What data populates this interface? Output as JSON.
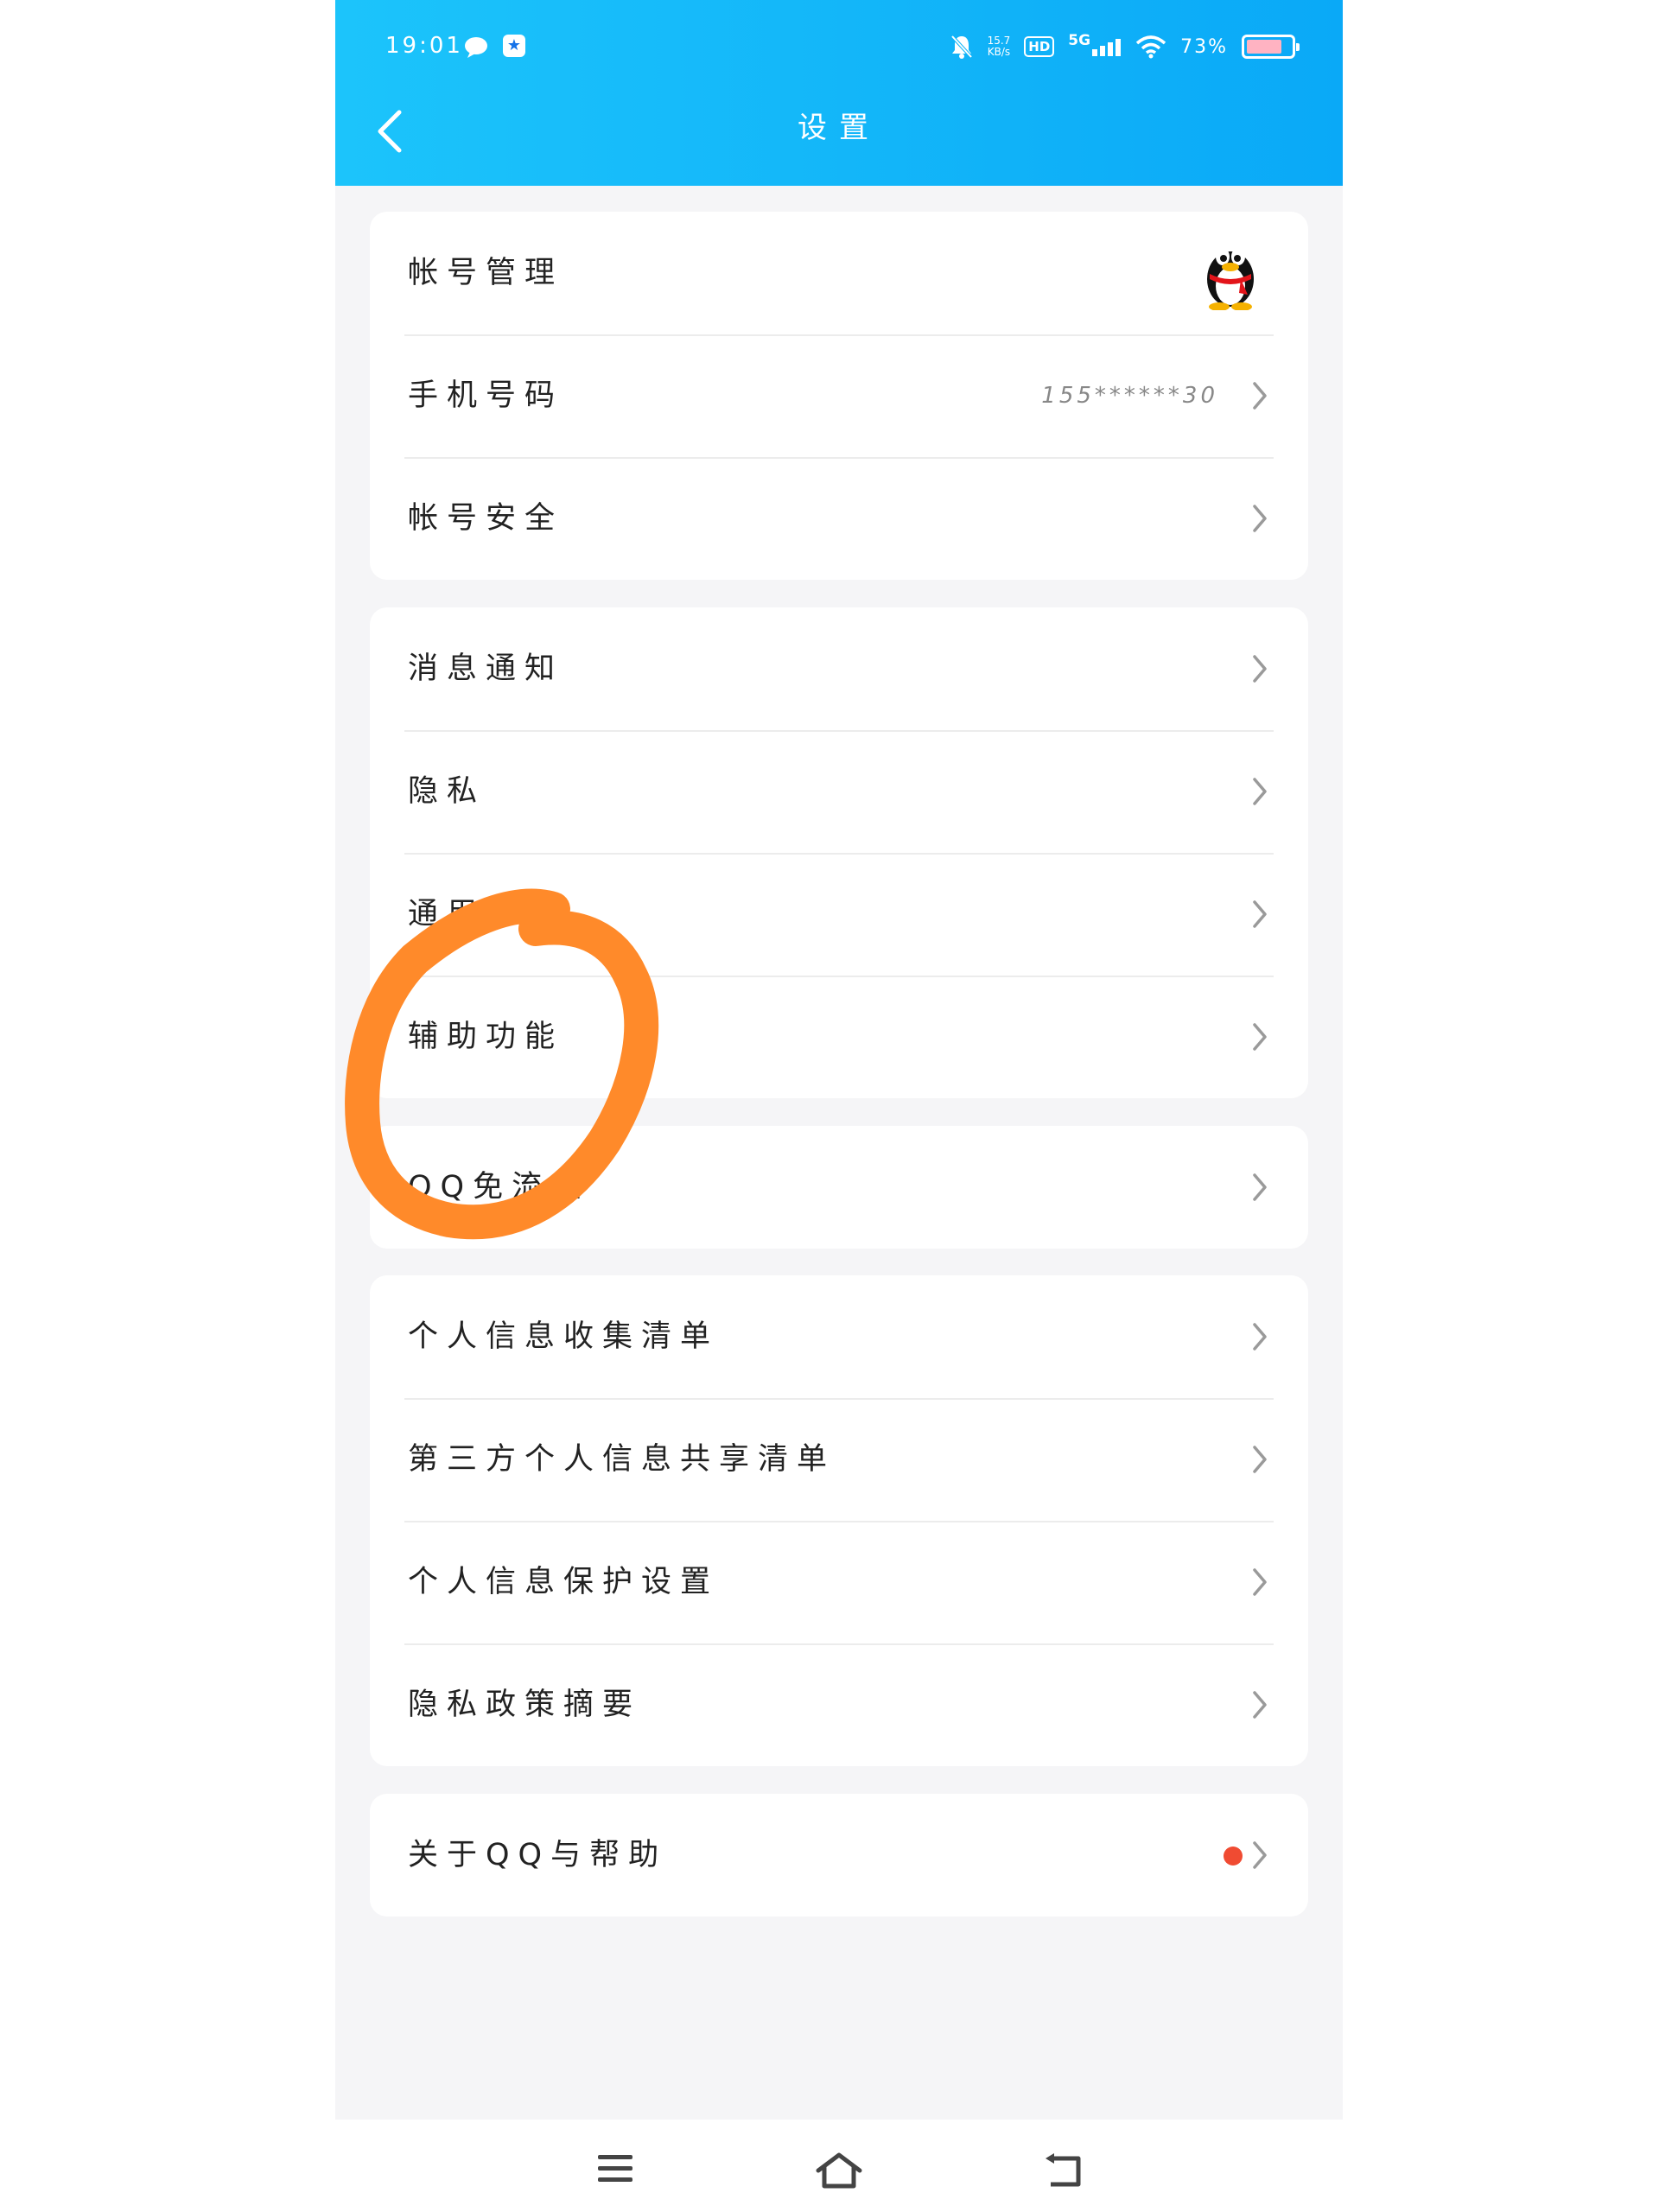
{
  "status_bar": {
    "time": "19:01",
    "net_speed": "15.7",
    "net_unit": "KB/s",
    "hd_badge": "HD",
    "network": "5G",
    "battery_percent": "73%"
  },
  "header": {
    "title": "设置"
  },
  "sections": [
    {
      "rows": [
        {
          "label": "帐号管理",
          "trailing": "avatar"
        },
        {
          "label": "手机号码",
          "value": "155******30"
        },
        {
          "label": "帐号安全"
        }
      ]
    },
    {
      "rows": [
        {
          "label": "消息通知"
        },
        {
          "label": "隐私"
        },
        {
          "label": "通用"
        },
        {
          "label": "辅助功能"
        }
      ]
    },
    {
      "rows": [
        {
          "label": "QQ免流量"
        }
      ]
    },
    {
      "rows": [
        {
          "label": "个人信息收集清单"
        },
        {
          "label": "第三方个人信息共享清单"
        },
        {
          "label": "个人信息保护设置"
        },
        {
          "label": "隐私政策摘要"
        }
      ]
    },
    {
      "rows": [
        {
          "label": "关于QQ与帮助",
          "badge": "red-dot"
        }
      ]
    }
  ],
  "colors": {
    "header_gradient_start": "#1cc4fb",
    "header_gradient_end": "#0aa9f7",
    "page_background": "#f5f5f7",
    "annotation": "#ff8a2a",
    "badge": "#f04b32"
  },
  "icons": {
    "back": "chevron-left-icon",
    "row_arrow": "chevron-right-icon",
    "account_avatar": "qq-penguin-icon",
    "nav": [
      "menu-icon",
      "home-icon",
      "back-nav-icon"
    ]
  }
}
